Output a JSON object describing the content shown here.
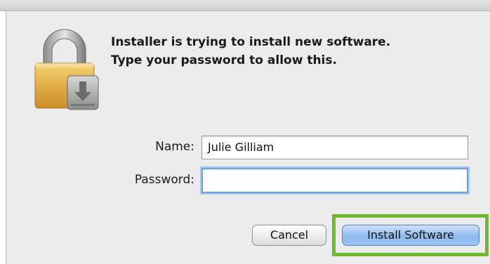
{
  "dialog": {
    "message_line1": "Installer is trying to install new software.",
    "message_line2": "Type your password to allow this.",
    "icon": "lock-icon"
  },
  "form": {
    "name_label": "Name:",
    "name_value": "Julie Gilliam",
    "password_label": "Password:",
    "password_value": ""
  },
  "buttons": {
    "cancel_label": "Cancel",
    "install_label": "Install Software"
  },
  "colors": {
    "highlight": "#6fb92e",
    "focus_ring": "#6ea1e0",
    "default_button": "#8fbaf0"
  }
}
